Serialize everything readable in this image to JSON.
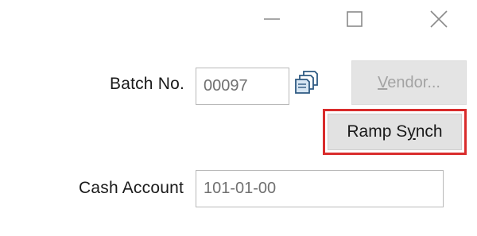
{
  "window_controls": {
    "minimize_icon": "minimize-icon",
    "maximize_icon": "maximize-icon",
    "close_icon": "close-icon",
    "icon_color": "#8a8a8a"
  },
  "form": {
    "batch_label": "Batch No.",
    "batch_value": "00097",
    "lookup_icon": "lookup-copy-icon",
    "vendor_button": {
      "prefix": "",
      "underlined": "V",
      "suffix": "endor..."
    },
    "ramp_button": {
      "prefix": "Ramp S",
      "underlined": "y",
      "suffix": "nch"
    },
    "cash_label": "Cash Account",
    "cash_value": "101-01-00"
  },
  "colors": {
    "highlight_border": "#d92c2c",
    "button_bg": "#e2e2e2",
    "disabled_text": "#a3a3a3"
  }
}
